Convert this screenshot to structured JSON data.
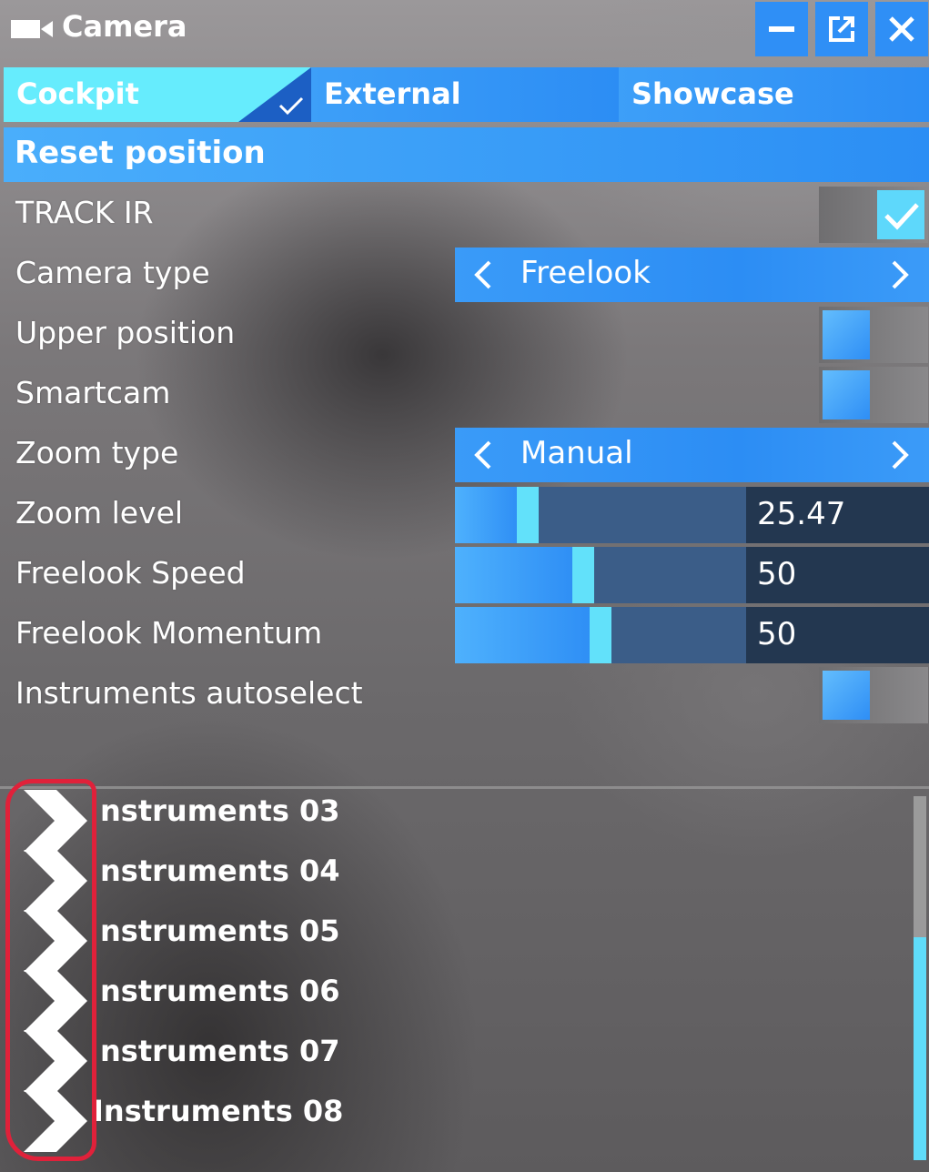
{
  "window": {
    "title": "Camera",
    "icons": {
      "camera": "video-camera-icon",
      "minimize": "minimize-icon",
      "popout": "popout-icon",
      "close": "close-icon"
    }
  },
  "tabs": [
    {
      "label": "Cockpit",
      "selected": true
    },
    {
      "label": "External",
      "selected": false
    },
    {
      "label": "Showcase",
      "selected": false
    }
  ],
  "reset_label": "Reset position",
  "settings": {
    "track_ir": {
      "label": "TRACK IR",
      "checked": true
    },
    "camera_type": {
      "label": "Camera type",
      "value": "Freelook"
    },
    "upper_position": {
      "label": "Upper position",
      "checked": false
    },
    "smartcam": {
      "label": "Smartcam",
      "checked": false
    },
    "zoom_type": {
      "label": "Zoom type",
      "value": "Manual"
    },
    "zoom_level": {
      "label": "Zoom level",
      "value": "25.47",
      "level": 0.25
    },
    "freelook_speed": {
      "label": "Freelook Speed",
      "value": "50",
      "level": 0.44
    },
    "freelook_momentum": {
      "label": "Freelook Momentum",
      "value": "50",
      "level": 0.5
    },
    "instruments_autoselect": {
      "label": "Instruments autoselect",
      "checked": false
    }
  },
  "instruments": [
    "nstruments 03",
    "nstruments 04",
    "nstruments 05",
    "nstruments 06",
    "nstruments 07",
    "Instruments 08"
  ],
  "colors": {
    "accent_blue": "#2f8ff6",
    "active_tab": "#66ecfd",
    "check_cyan": "#5ed8fb",
    "slider_dark": "#233750",
    "annotation_red": "#e0213a"
  }
}
